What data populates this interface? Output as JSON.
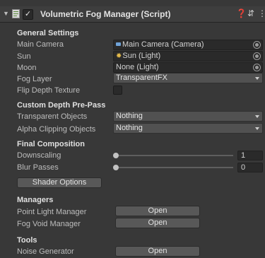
{
  "header": {
    "title": "Volumetric Fog Manager (Script)",
    "enabled": true,
    "icons": [
      "foldout-arrow-icon",
      "script-icon",
      "help-icon",
      "preset-icon",
      "kebab-menu-icon"
    ]
  },
  "general": {
    "title": "General Settings",
    "main_camera_label": "Main Camera",
    "main_camera_value": "Main Camera (Camera)",
    "sun_label": "Sun",
    "sun_value": "Sun (Light)",
    "moon_label": "Moon",
    "moon_value": "None (Light)",
    "fog_layer_label": "Fog Layer",
    "fog_layer_value": "TransparentFX",
    "flip_depth_label": "Flip Depth Texture",
    "flip_depth_checked": false
  },
  "custom_depth": {
    "title": "Custom Depth Pre-Pass",
    "transparent_label": "Transparent Objects",
    "transparent_value": "Nothing",
    "alpha_clip_label": "Alpha Clipping Objects",
    "alpha_clip_value": "Nothing"
  },
  "final_composition": {
    "title": "Final Composition",
    "downscaling_label": "Downscaling",
    "downscaling_value": "1",
    "blur_label": "Blur Passes",
    "blur_value": "0",
    "shader_options_label": "Shader Options"
  },
  "managers": {
    "title": "Managers",
    "point_light_label": "Point Light Manager",
    "point_light_button": "Open",
    "fog_void_label": "Fog Void Manager",
    "fog_void_button": "Open"
  },
  "tools": {
    "title": "Tools",
    "noise_label": "Noise Generator",
    "noise_button": "Open"
  },
  "colors": {
    "background": "#383838",
    "field": "#2a2a2a",
    "dropdown": "#515151",
    "button": "#585858",
    "text": "#c4c4c4",
    "section_text": "#e0e0e0"
  }
}
